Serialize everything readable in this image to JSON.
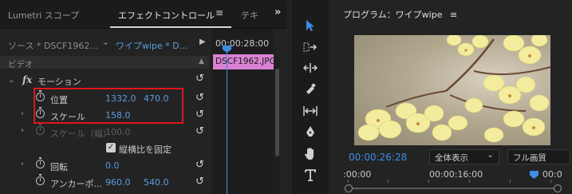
{
  "tabs": {
    "lumetri": "Lumetri スコープ",
    "effect_controls": "エフェクトコントロール",
    "menu_icon": "≡",
    "text_tab": "テキ",
    "overflow": "»"
  },
  "source": {
    "master": "ソース * DSCF1962...",
    "sequence": "ワイプwipe * D..."
  },
  "section_label": "ビデオ",
  "motion_label": "モーション",
  "params": {
    "position": {
      "name": "位置",
      "x": "1332.0",
      "y": "470.0"
    },
    "scale": {
      "name": "スケール",
      "value": "158.0"
    },
    "scale_width": {
      "name": "スケール（幅）",
      "value": "100.0"
    },
    "uniform_scale": "縦横比を固定",
    "rotation": {
      "name": "回転",
      "value": "0.0"
    },
    "anchor": {
      "name": "アンカーポ...",
      "x": "960.0",
      "y": "540.0"
    }
  },
  "timeline": {
    "timecode": "00:00:28:00",
    "clip_name": "DSCF1962.JPG"
  },
  "monitor": {
    "title": "プログラム：ワイプwipe",
    "menu_icon": "≡",
    "timecode": "00:00:26:28",
    "zoom": "全体表示",
    "resolution": "フル画質",
    "ruler_labels": [
      ":00:00",
      "00:00:16:00",
      "00:0"
    ]
  },
  "icons": {
    "selection": "selection-tool-icon",
    "track_select": "track-select-icon",
    "ripple": "ripple-edit-icon",
    "razor": "razor-icon",
    "slip": "slip-icon",
    "pen": "pen-icon",
    "hand": "hand-icon",
    "type": "type-icon"
  },
  "colors": {
    "accent": "#3d8de3",
    "highlight": "#e0151b",
    "clip": "#d982d3"
  }
}
